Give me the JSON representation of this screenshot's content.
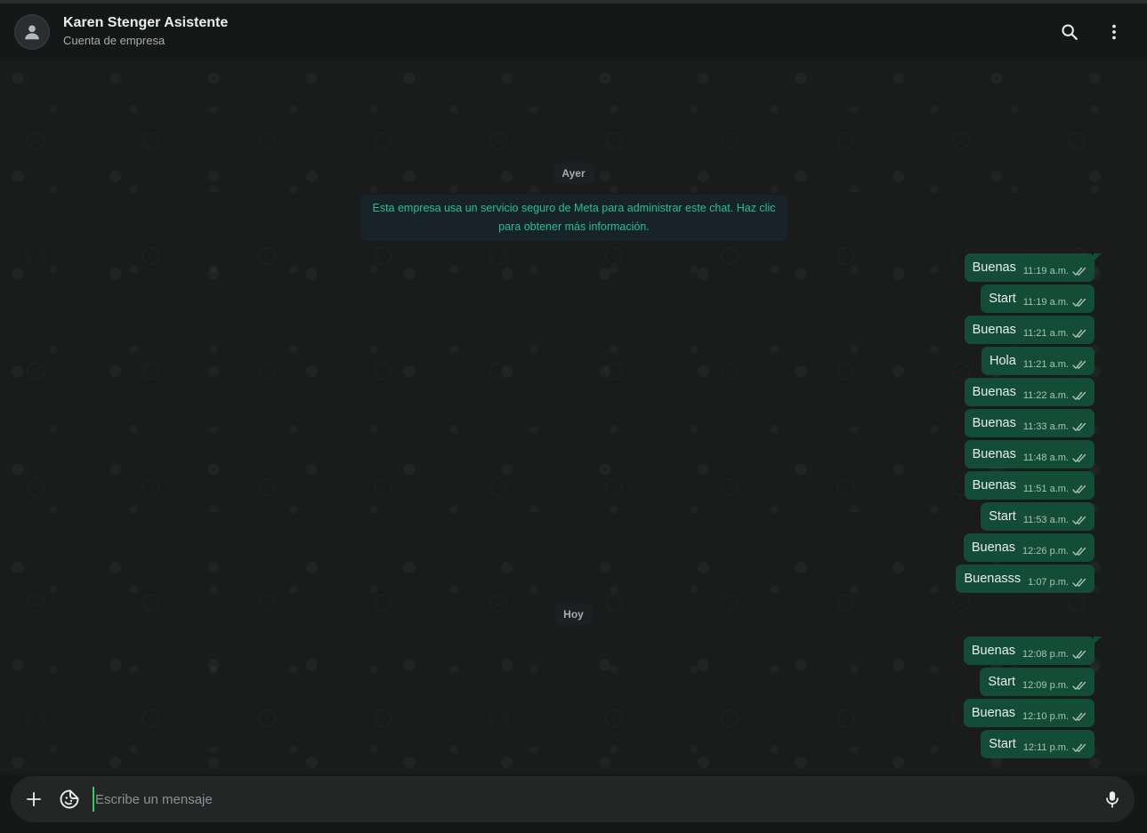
{
  "header": {
    "contact_name": "Karen Stenger Asistente",
    "contact_subtitle": "Cuenta de empresa",
    "icons": {
      "avatar": "person-icon",
      "search": "search-icon",
      "menu": "kebab-menu-icon"
    }
  },
  "chat": {
    "day_yesterday": "Ayer",
    "notice_line1": "Esta empresa usa un servicio seguro de Meta para administrar este chat. Haz clic",
    "notice_line2": "para obtener más información.",
    "yesterday_messages": [
      {
        "text": "Buenas",
        "time": "11:19 a.m."
      },
      {
        "text": "Start",
        "time": "11:19 a.m."
      },
      {
        "text": "Buenas",
        "time": "11:21 a.m."
      },
      {
        "text": "Hola",
        "time": "11:21 a.m."
      },
      {
        "text": "Buenas",
        "time": "11:22 a.m."
      },
      {
        "text": "Buenas",
        "time": "11:33 a.m."
      },
      {
        "text": "Buenas",
        "time": "11:48 a.m."
      },
      {
        "text": "Buenas",
        "time": "11:51 a.m."
      },
      {
        "text": "Start",
        "time": "11:53 a.m."
      },
      {
        "text": "Buenas",
        "time": "12:26 p.m."
      },
      {
        "text": "Buenasss",
        "time": "1:07 p.m."
      }
    ],
    "day_today": "Hoy",
    "today_messages": [
      {
        "text": "Buenas",
        "time": "12:08 p.m."
      },
      {
        "text": "Start",
        "time": "12:09 p.m."
      },
      {
        "text": "Buenas",
        "time": "12:10 p.m."
      },
      {
        "text": "Start",
        "time": "12:11 p.m."
      }
    ]
  },
  "composer": {
    "placeholder": "Escribe un mensaje",
    "icons": {
      "attach": "plus-icon",
      "sticker": "sticker-icon",
      "mic": "microphone-icon"
    }
  },
  "colors": {
    "background": "#161717",
    "outgoing_bubble": "#144d37",
    "notice_text": "#24c28a",
    "read_ticks": "#a7c3b8"
  }
}
